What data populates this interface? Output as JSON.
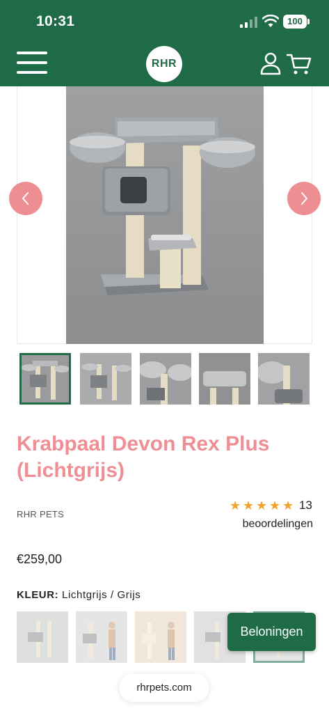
{
  "status_bar": {
    "time": "10:31",
    "battery": "100"
  },
  "header": {
    "logo": "RHR",
    "icons": [
      "menu-icon",
      "user-icon",
      "cart-icon"
    ]
  },
  "gallery": {
    "main_image": "cat-tree-devon-rex-plus-light-grey",
    "prev_icon": "chevron-left-icon",
    "next_icon": "chevron-right-icon",
    "thumbnail_count": 5,
    "active_thumbnail": 1
  },
  "product": {
    "title": "Krabpaal Devon Rex Plus (Lichtgrijs)",
    "brand": "RHR PETS",
    "rating_stars": 5,
    "review_count": "13",
    "reviews_label": "beoordelingen",
    "price": "€259,00",
    "color_label": "KLEUR:",
    "color_value": "Lichtgrijs / Grijs"
  },
  "rewards_button": "Beloningen",
  "browser": {
    "url": "rhrpets.com"
  },
  "colors": {
    "brand_green": "#1f6b48",
    "accent_pink": "#ee8f95",
    "star": "#f2a12a"
  }
}
